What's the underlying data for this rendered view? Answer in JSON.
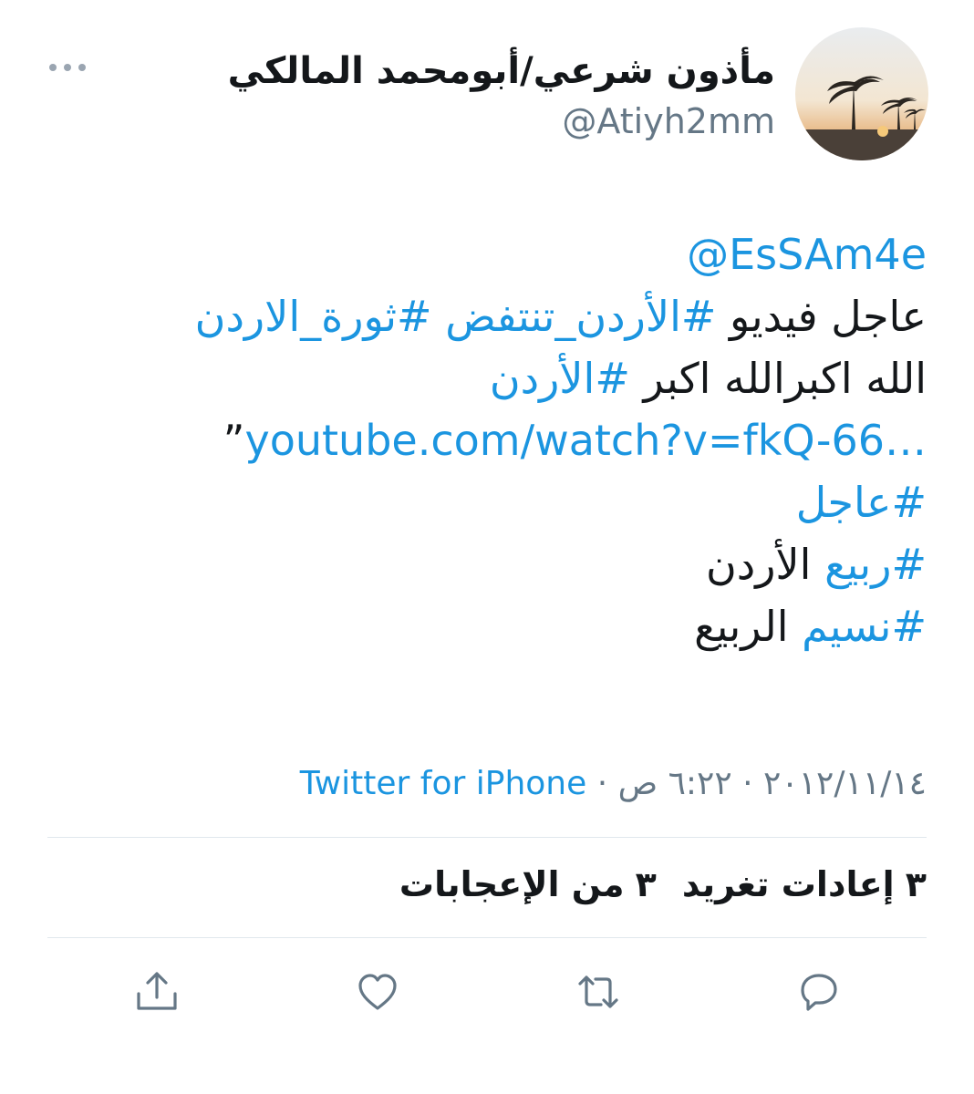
{
  "user": {
    "display_name": "مأذون شرعي/أبومحمد المالكي",
    "handle": "@Atiyh2mm",
    "avatar_icon": "palm-trees-sunset-photo"
  },
  "more_icon": "ellipsis-icon",
  "tweet": {
    "mention": "@EsSAm4e",
    "line2": {
      "text1": "عاجل فيديو ",
      "tag1": "#الأردن_تنتفض",
      "tag2": "#ثورة_الاردن"
    },
    "line3": {
      "text1": "الله اكبرالله اكبر ",
      "tag1": "#الأردن"
    },
    "line4": {
      "link": "youtube.com/watch?v=fkQ-66…",
      "quote": "”"
    },
    "line5": {
      "tag1": "#عاجل"
    },
    "line6": {
      "tag1": "#ربيع",
      "text1": " الأردن"
    },
    "line7": {
      "tag1": "#نسيم",
      "text1": " الربيع"
    }
  },
  "meta": {
    "date": "٢٠١٢/١١/١٤",
    "separator": " · ",
    "time": "٦:٢٢ ص",
    "source": "Twitter for iPhone"
  },
  "stats": {
    "retweets_count": "٣",
    "retweets_label": "إعادات تغريد",
    "likes_count": "٣",
    "likes_label": "من الإعجابات"
  },
  "actions": {
    "reply_icon": "reply-icon",
    "retweet_icon": "retweet-icon",
    "like_icon": "heart-icon",
    "share_icon": "share-icon"
  },
  "colors": {
    "link": "#1b95e0",
    "text": "#14171a",
    "secondary": "#657786",
    "divider": "#e1e8ed"
  }
}
